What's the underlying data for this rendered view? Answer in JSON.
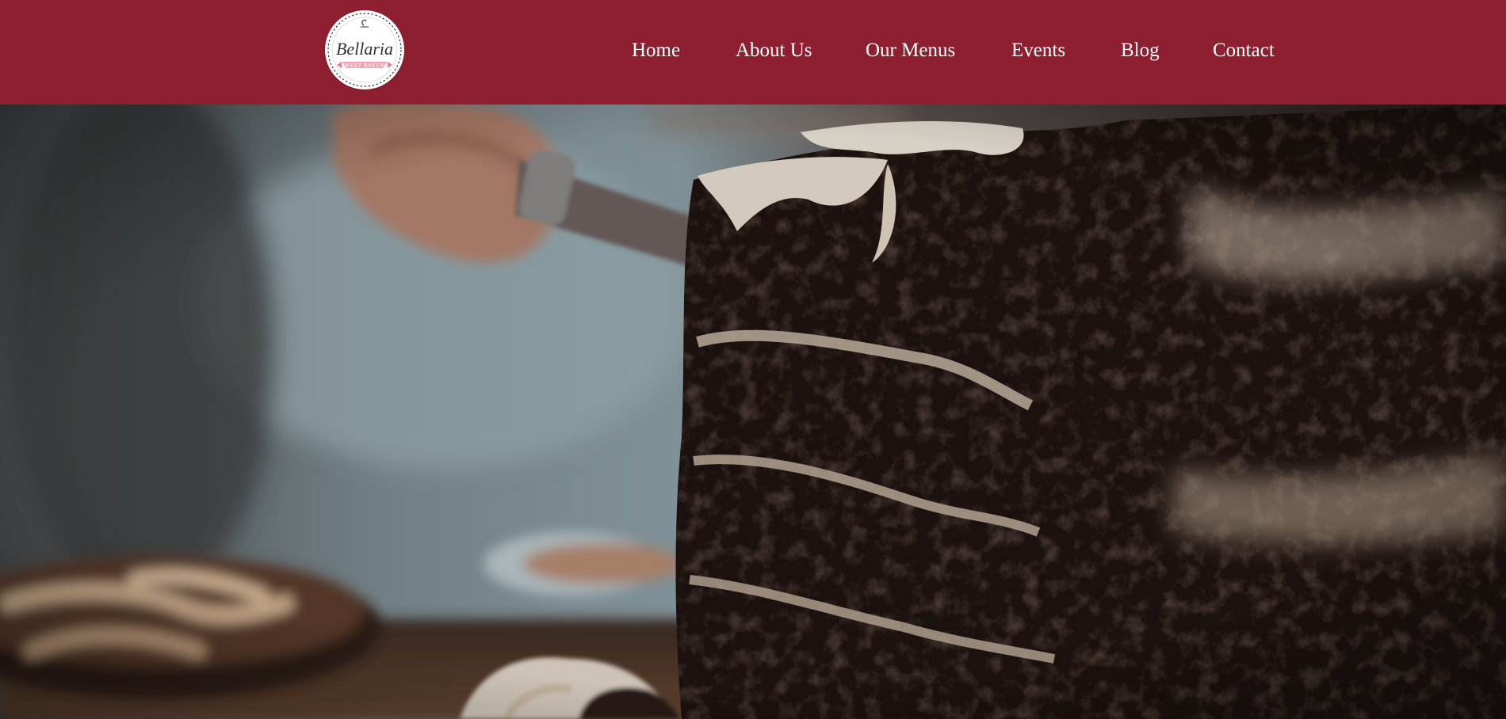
{
  "brand": {
    "logo_text": "Bellaria",
    "logo_ribbon_text": "SWEET BAKERY",
    "header_color": "#8e1f31",
    "logo_accent_color": "#f3a3b4"
  },
  "nav": {
    "items": [
      {
        "label": "Home"
      },
      {
        "label": "About Us"
      },
      {
        "label": "Our Menus"
      },
      {
        "label": "Events"
      },
      {
        "label": "Blog"
      },
      {
        "label": "Contact"
      }
    ]
  },
  "hero": {
    "image_subject": "chocolate-layer-cake-being-sliced"
  }
}
